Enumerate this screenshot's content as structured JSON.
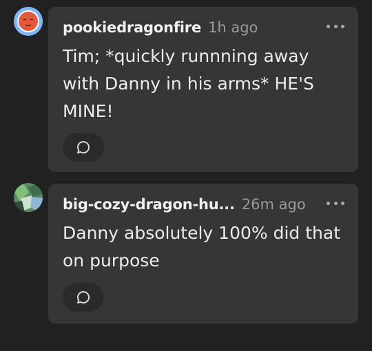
{
  "colors": {
    "background": "#212121",
    "bubble": "#363636",
    "username": "#f0f0f0",
    "timestamp": "#9a9a9a",
    "avatar1_ring": "#7fb7ff",
    "avatar1_fill": "#e25a3a"
  },
  "comments": [
    {
      "username": "pookiedragonfire",
      "time": "1h ago",
      "text": "Tim; *quickly runnning away with Danny in his arms* HE'S MINE!",
      "avatar_icon": "red-face-avatar",
      "more_icon": "ellipsis-icon",
      "reply_icon": "speech-bubble-icon"
    },
    {
      "username": "big-cozy-dragon-hu...",
      "time": "26m ago",
      "text": "Danny absolutely 100% did that on purpose",
      "avatar_icon": "green-art-avatar",
      "more_icon": "ellipsis-icon",
      "reply_icon": "speech-bubble-icon"
    }
  ]
}
